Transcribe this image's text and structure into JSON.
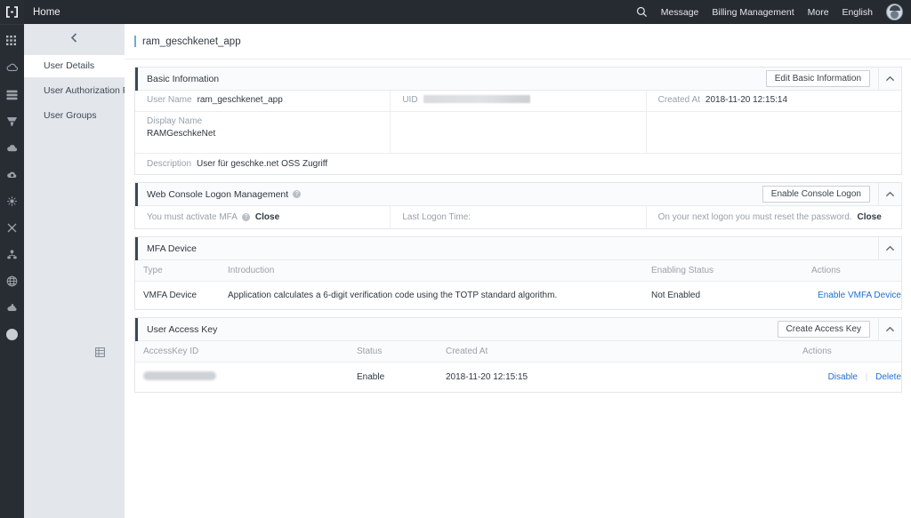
{
  "topbar": {
    "logo_icon": "bracket-logo-icon",
    "home_label": "Home",
    "search_icon": "search-icon",
    "links": [
      {
        "label": "Message",
        "name": "message"
      },
      {
        "label": "Billing Management",
        "name": "billing-management"
      },
      {
        "label": "More",
        "name": "more"
      },
      {
        "label": "English",
        "name": "english"
      }
    ],
    "avatar_icon": "avatar"
  },
  "rail": {
    "icons": [
      "apps-grid-icon",
      "cloud-icon",
      "database-stack-icon",
      "shield-icon",
      "cloud-storage-icon",
      "cloud-monitor-icon",
      "network-node-icon",
      "cross-connect-icon",
      "sitemap-icon",
      "globe-icon",
      "cloud-service-icon",
      "circle-dot-icon"
    ]
  },
  "sidebar": {
    "back_icon": "chevron-left-icon",
    "toggle_icon": "sidebar-toggle-icon",
    "items": [
      {
        "label": "User Details",
        "active": true
      },
      {
        "label": "User Authorization P...",
        "active": false
      },
      {
        "label": "User Groups",
        "active": false
      }
    ]
  },
  "page": {
    "title": "ram_geschkenet_app",
    "accent_color": "#6fa8dc"
  },
  "basic_information": {
    "title": "Basic Information",
    "edit_button": "Edit Basic Information",
    "collapse_icon": "chevron-up-icon",
    "user_name_label": "User Name",
    "user_name_value": "ram_geschkenet_app",
    "uid_label": "UID",
    "uid_value": "",
    "created_at_label": "Created At",
    "created_at_value": "2018-11-20 12:15:14",
    "display_name_label": "Display Name",
    "display_name_value": "RAMGeschkeNet",
    "description_label": "Description",
    "description_value": "User für geschke.net OSS Zugriff"
  },
  "web_console_logon": {
    "title": "Web Console Logon Management",
    "help_icon": "help-icon",
    "enable_button": "Enable Console Logon",
    "collapse_icon": "chevron-up-icon",
    "mfa_text": "You must activate MFA",
    "mfa_help_icon": "help-icon",
    "mfa_status": "Close",
    "last_logon_label": "Last Logon Time:",
    "reset_password_text": "On your next logon you must reset the password.",
    "reset_password_status": "Close"
  },
  "mfa_device": {
    "title": "MFA Device",
    "collapse_icon": "chevron-up-icon",
    "columns": [
      "Type",
      "Introduction",
      "Enabling Status",
      "Actions"
    ],
    "rows": [
      {
        "type": "VMFA Device",
        "introduction": "Application calculates a 6-digit verification code using the TOTP standard algorithm.",
        "status": "Not Enabled",
        "action": "Enable VMFA Device"
      }
    ]
  },
  "user_access_key": {
    "title": "User Access Key",
    "create_button": "Create Access Key",
    "collapse_icon": "chevron-up-icon",
    "columns": [
      "AccessKey ID",
      "Status",
      "Created At",
      "Actions"
    ],
    "rows": [
      {
        "access_key_id": "",
        "status": "Enable",
        "status_color": "#3aa93a",
        "created_at": "2018-11-20 12:15:15",
        "action_disable": "Disable",
        "action_delete": "Delete"
      }
    ]
  }
}
